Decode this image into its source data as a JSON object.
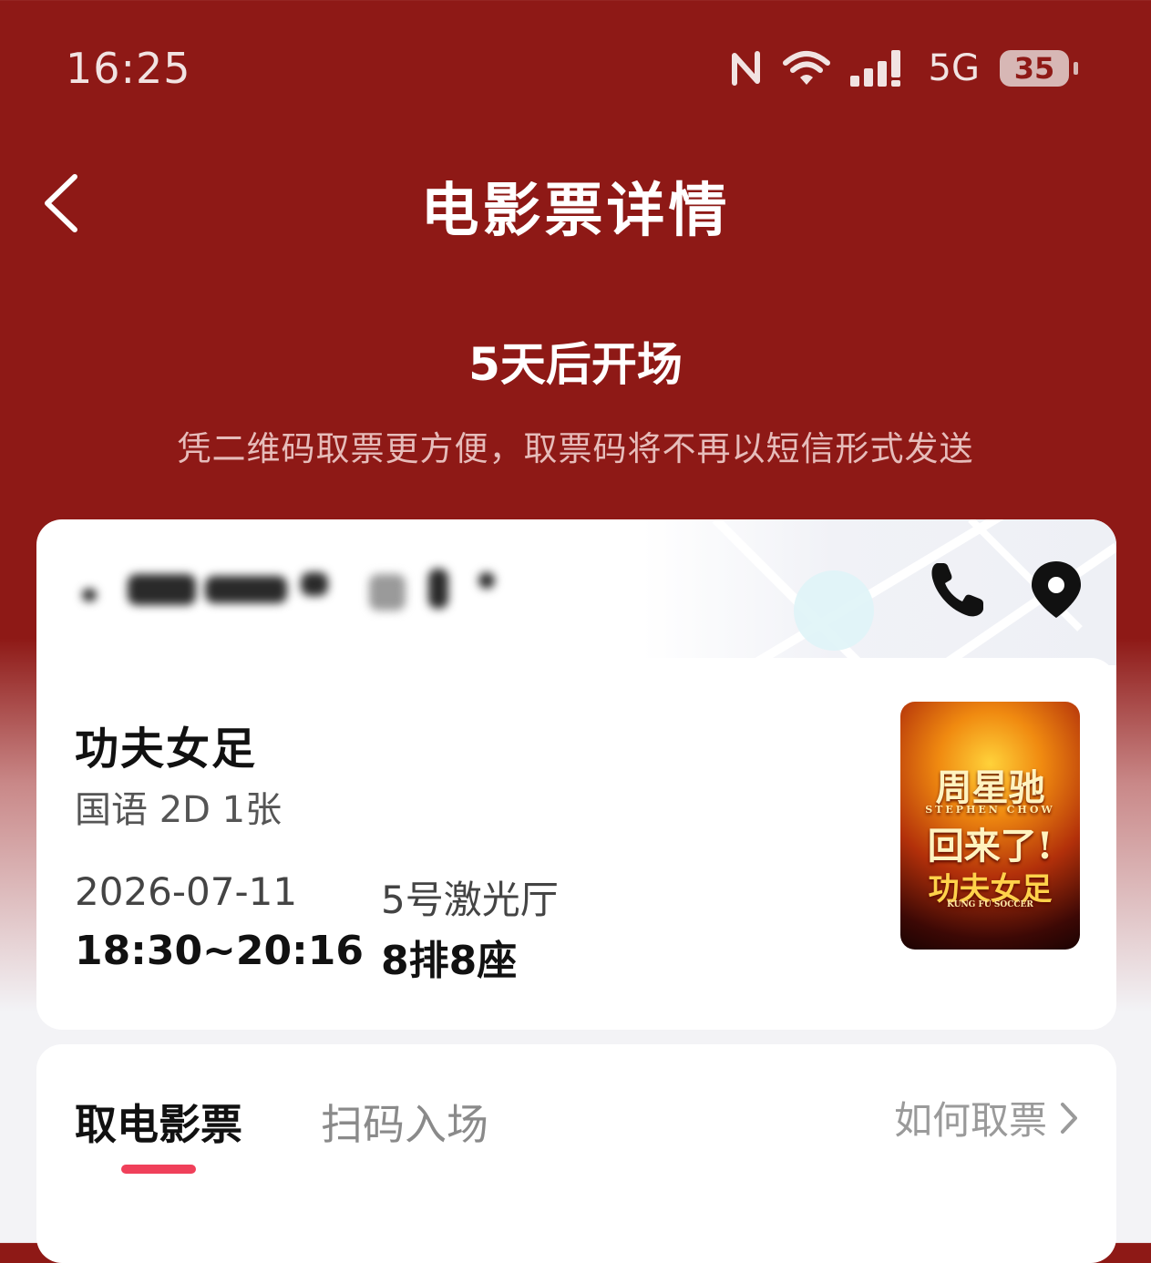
{
  "status_bar": {
    "time": "16:25",
    "network": "5G",
    "battery": "35",
    "icons": [
      "nfc-icon",
      "wifi-icon",
      "signal-icon"
    ]
  },
  "nav": {
    "title": "电影票详情",
    "back_icon": "chevron-left-icon"
  },
  "header": {
    "countdown": "5天后开场",
    "hint": "凭二维码取票更方便，取票码将不再以短信形式发送"
  },
  "cinema": {
    "icons": [
      "phone-icon",
      "location-pin-icon"
    ]
  },
  "movie": {
    "title": "功夫女足",
    "meta": "国语 2D 1张",
    "date": "2026-07-11",
    "time": "18:30~20:16",
    "hall": "5号激光厅",
    "seat": "8排8座",
    "poster": {
      "line1": "周星驰",
      "line2": "STEPHEN CHOW",
      "line3": "回来了!",
      "line4": "功夫女足",
      "line5": "KUNG FU SOCCER"
    }
  },
  "tabs": {
    "items": [
      "取电影票",
      "扫码入场"
    ],
    "help": "如何取票"
  },
  "colors": {
    "header_bg": "#8e1916",
    "accent": "#f0405a",
    "card_bg": "#ffffff"
  }
}
